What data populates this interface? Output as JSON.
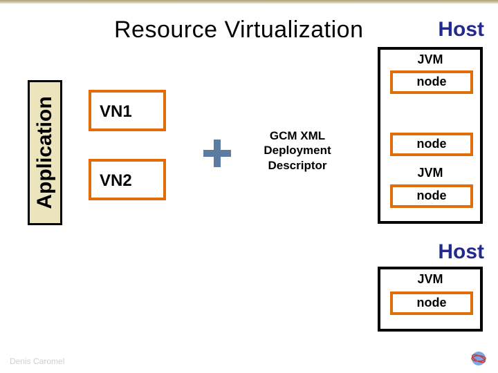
{
  "title": "Resource Virtualization",
  "footer": "Denis Caromel",
  "application_label": "Application",
  "vn1": "VN1",
  "vn2": "VN2",
  "gcm_line1": "GCM XML",
  "gcm_line2": "Deployment",
  "gcm_line3": "Descriptor",
  "host_label": "Host",
  "jvm_label": "JVM",
  "node_label": "node",
  "colors": {
    "accent": "#e36c0a",
    "brand": "#232a8f",
    "appbar": "#ece4bd",
    "plus": "#5c7ba0"
  }
}
